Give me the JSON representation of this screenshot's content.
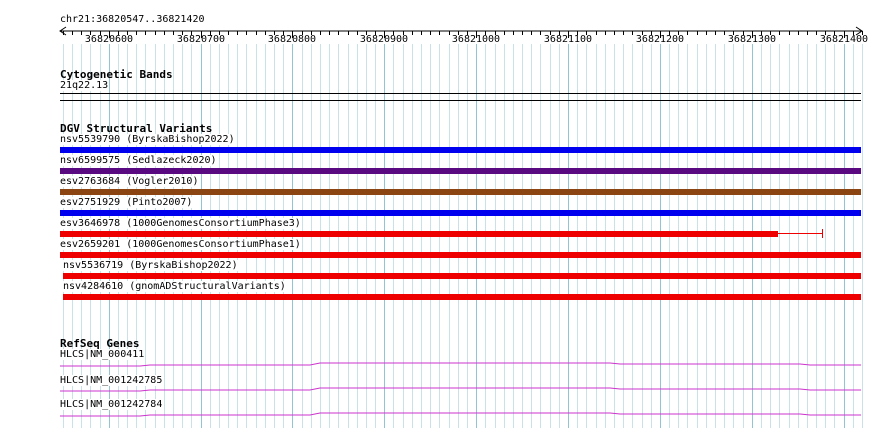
{
  "ruler": {
    "location": "chr21:36820547..36821420",
    "start": 36820547,
    "end": 36821420,
    "ticks": [
      36820600,
      36820700,
      36820800,
      36820900,
      36821000,
      36821100,
      36821200,
      36821300,
      36821400
    ]
  },
  "cytoband": {
    "title": "Cytogenetic Bands",
    "band": "21q22.13"
  },
  "dgv": {
    "title": "DGV Structural Variants",
    "variants": [
      {
        "label": "nsv5539790 (ByrskaBishop2022)",
        "color": "#0000ee"
      },
      {
        "label": "nsv6599575 (Sedlazeck2020)",
        "color": "#5a0a80"
      },
      {
        "label": "esv2763684 (Vogler2010)",
        "color": "#8b4513"
      },
      {
        "label": "esv2751929 (Pinto2007)",
        "color": "#0000ee"
      },
      {
        "label": "esv3646978 (1000GenomesConsortiumPhase3)",
        "color": "#ee0000"
      },
      {
        "label": "esv2659201 (1000GenomesConsortiumPhase1)",
        "color": "#ee0000"
      },
      {
        "label": "nsv5536719 (ByrskaBishop2022)",
        "color": "#ee0000"
      },
      {
        "label": "nsv4284610 (gnomADStructuralVariants)",
        "color": "#ee0000"
      }
    ]
  },
  "refseq": {
    "title": "RefSeq Genes",
    "genes": [
      {
        "label": "HLCS|NM_000411",
        "color": "#cc33cc"
      },
      {
        "label": "HLCS|NM_001242785",
        "color": "#cc33cc"
      },
      {
        "label": "HLCS|NM_001242784",
        "color": "#cc33cc"
      }
    ]
  }
}
